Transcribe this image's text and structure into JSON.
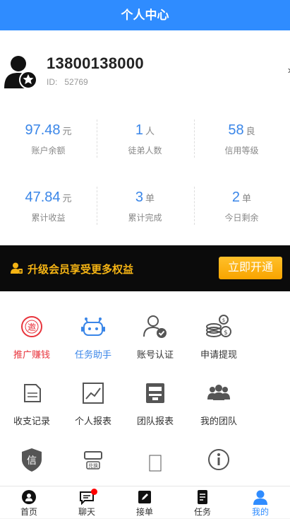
{
  "header": {
    "title": "个人中心"
  },
  "profile": {
    "phone": "13800138000",
    "id_label": "ID:",
    "id_value": "52769",
    "chevron": "›"
  },
  "stats": [
    {
      "value": "97.48",
      "unit": "元",
      "label": "账户余额"
    },
    {
      "value": "1",
      "unit": "人",
      "label": "徒弟人数"
    },
    {
      "value": "58",
      "unit": "良",
      "label": "信用等级"
    },
    {
      "value": "47.84",
      "unit": "元",
      "label": "累计收益"
    },
    {
      "value": "3",
      "unit": "单",
      "label": "累计完成"
    },
    {
      "value": "2",
      "unit": "单",
      "label": "今日剩余"
    }
  ],
  "banner": {
    "text": "升级会员享受更多权益",
    "button": "立即开通",
    "accent": "#f5b414"
  },
  "menu": [
    {
      "label": "推广赚钱",
      "icon": "invite-icon",
      "color": "#e8343c"
    },
    {
      "label": "任务助手",
      "icon": "robot-icon",
      "color": "#3a86e8"
    },
    {
      "label": "账号认证",
      "icon": "user-check-icon",
      "color": "#333"
    },
    {
      "label": "申请提现",
      "icon": "coins-icon",
      "color": "#333"
    },
    {
      "label": "收支记录",
      "icon": "receipt-icon",
      "color": "#333"
    },
    {
      "label": "个人报表",
      "icon": "chart-icon",
      "color": "#333"
    },
    {
      "label": "团队报表",
      "icon": "report-icon",
      "color": "#333"
    },
    {
      "label": "我的团队",
      "icon": "team-icon",
      "color": "#333"
    },
    {
      "label": "",
      "icon": "credit-shield-icon",
      "color": "#333"
    },
    {
      "label": "",
      "icon": "exchange-card-icon",
      "color": "#333"
    },
    {
      "label": "",
      "icon": "tablet-icon",
      "color": "#333"
    },
    {
      "label": "",
      "icon": "info-icon",
      "color": "#333"
    }
  ],
  "exchange_card_text": "兑换",
  "credit_char": "信",
  "tabs": [
    {
      "label": "首页",
      "icon": "home-icon"
    },
    {
      "label": "聊天",
      "icon": "chat-icon"
    },
    {
      "label": "接单",
      "icon": "edit-icon"
    },
    {
      "label": "任务",
      "icon": "task-icon"
    },
    {
      "label": "我的",
      "icon": "profile-icon",
      "active": true
    }
  ],
  "brand_color": "#2f8cff"
}
